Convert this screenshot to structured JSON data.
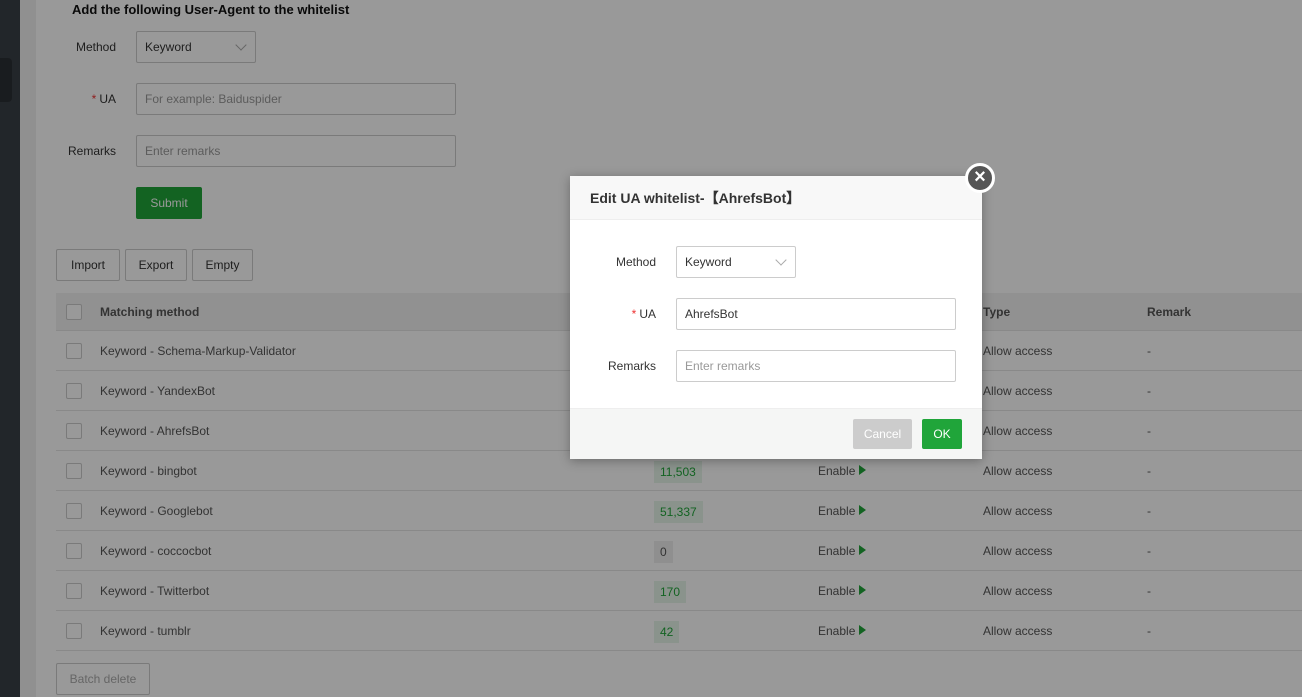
{
  "form": {
    "title": "Add the following User-Agent to the whitelist",
    "method_label": "Method",
    "method_value": "Keyword",
    "ua_label": "UA",
    "ua_placeholder": "For example: Baiduspider",
    "remarks_label": "Remarks",
    "remarks_placeholder": "Enter remarks",
    "submit": "Submit"
  },
  "toolbar": {
    "import": "Import",
    "export": "Export",
    "empty": "Empty"
  },
  "table": {
    "headers": {
      "method": "Matching method",
      "type": "Type",
      "remark": "Remark"
    },
    "rows": [
      {
        "method": "Keyword - Schema-Markup-Validator",
        "hits": "",
        "status": "",
        "type": "Allow access",
        "remark": "-"
      },
      {
        "method": "Keyword - YandexBot",
        "hits": "",
        "status": "",
        "type": "Allow access",
        "remark": "-"
      },
      {
        "method": "Keyword - AhrefsBot",
        "hits": "",
        "status": "",
        "type": "Allow access",
        "remark": "-"
      },
      {
        "method": "Keyword - bingbot",
        "hits": "11,503",
        "status": "Enable",
        "type": "Allow access",
        "remark": "-"
      },
      {
        "method": "Keyword - Googlebot",
        "hits": "51,337",
        "status": "Enable",
        "type": "Allow access",
        "remark": "-"
      },
      {
        "method": "Keyword - coccocbot",
        "hits": "0",
        "status": "Enable",
        "type": "Allow access",
        "remark": "-"
      },
      {
        "method": "Keyword - Twitterbot",
        "hits": "170",
        "status": "Enable",
        "type": "Allow access",
        "remark": "-"
      },
      {
        "method": "Keyword - tumblr",
        "hits": "42",
        "status": "Enable",
        "type": "Allow access",
        "remark": "-"
      }
    ]
  },
  "batch_delete": "Batch delete",
  "modal": {
    "title": "Edit UA whitelist-【AhrefsBot】",
    "method_label": "Method",
    "method_value": "Keyword",
    "ua_label": "UA",
    "ua_value": "AhrefsBot",
    "remarks_label": "Remarks",
    "remarks_placeholder": "Enter remarks",
    "cancel": "Cancel",
    "ok": "OK",
    "required_mark": "*"
  },
  "colors": {
    "accent": "#20a53a"
  }
}
